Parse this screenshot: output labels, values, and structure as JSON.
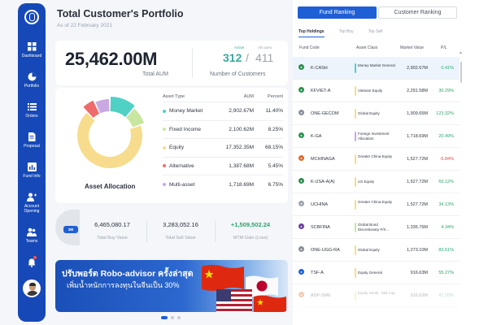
{
  "sidebar": {
    "items": [
      {
        "label": "Dashboard",
        "icon": "dashboard-icon"
      },
      {
        "label": "Portfolio",
        "icon": "pie-chart-icon"
      },
      {
        "label": "Orders",
        "icon": "list-icon"
      },
      {
        "label": "Proposal",
        "icon": "document-icon"
      },
      {
        "label": "Fund Info",
        "icon": "bar-chart-icon"
      },
      {
        "label": "Account Opening",
        "icon": "add-user-icon"
      },
      {
        "label": "Teams",
        "icon": "team-icon"
      }
    ]
  },
  "portfolio": {
    "title": "Total Customer's Portfolio",
    "date": "As of 22 February 2021",
    "aum_value": "25,462.00M",
    "aum_label": "Total AUM",
    "active_label": "Active",
    "allusers_label": "All users",
    "active_count": "312",
    "slash": "/",
    "all_count": "411",
    "customers_label": "Number of Customers"
  },
  "allocation": {
    "title": "Asset Allocation",
    "headers": {
      "type": "Asset Type",
      "aum": "AUM",
      "percent": "Percent"
    },
    "rows": [
      {
        "type": "Money Market",
        "aum": "2,902.67M",
        "percent": "11.40%",
        "color": "#4fd1c5"
      },
      {
        "type": "Fixed Income",
        "aum": "2,100.62M",
        "percent": "8.25%",
        "color": "#c8e6a0"
      },
      {
        "type": "Equity",
        "aum": "17,352.35M",
        "percent": "68.15%",
        "color": "#f6dc8c"
      },
      {
        "type": "Alternative",
        "aum": "1,387.68M",
        "percent": "5.45%",
        "color": "#ef6b6b"
      },
      {
        "type": "Multi-asset",
        "aum": "1,718.69M",
        "percent": "6.75%",
        "color": "#c9a8e3"
      }
    ]
  },
  "trading": {
    "period": "3M",
    "buy_value": "6,465,080.17",
    "buy_label": "Total Buy Value",
    "sell_value": "3,283,052.16",
    "sell_label": "Total Sell Value",
    "mtm_value": "+1,509,502.24",
    "mtm_label": "MTM Gain (Loss)"
  },
  "banner": {
    "line1": "ปรับพอร์ต Robo-advisor ครั้งล่าสุด",
    "line2": "เพิ่มน้ำหนักการลงทุนในจีนเป็น 30%"
  },
  "ranking": {
    "tab_fund": "Fund Ranking",
    "tab_customer": "Customer Ranking",
    "subtabs": [
      "Top Holdings",
      "Top Buy",
      "Top Sell"
    ],
    "headers": {
      "code": "Fund Code",
      "class": "Asset Class",
      "mv": "Market Value",
      "pl": "P/L"
    },
    "rows": [
      {
        "code": "K-CASH",
        "class": "Money Market General",
        "mv": "2,902.67M",
        "pl": "0.41%",
        "bar": "#4fd1c5",
        "icon": "#2f8f4e"
      },
      {
        "code": "KFVIET-A",
        "class": "Vietnam Equity",
        "mv": "2,291.58M",
        "pl": "30.29%",
        "bar": "#f6dc8c",
        "icon": "#2f8f4e"
      },
      {
        "code": "ONE-GECOM",
        "class": "Global Equity",
        "mv": "1,909.65M",
        "pl": "123.32%",
        "bar": "#f6dc8c",
        "icon": "#8a8f98"
      },
      {
        "code": "K-GA",
        "class": "Foreign Investment Allocation",
        "mv": "1,718.69M",
        "pl": "20.49%",
        "bar": "#c9a8e3",
        "icon": "#2f8f4e"
      },
      {
        "code": "MCHINAGA",
        "class": "Greater China Equity",
        "mv": "1,527.72M",
        "pl": "-5.84%",
        "bar": "#f6dc8c",
        "icon": "#e06a2c"
      },
      {
        "code": "K-USA-A(A)",
        "class": "US Equity",
        "mv": "1,527.72M",
        "pl": "69.12%",
        "bar": "#f6dc8c",
        "icon": "#2f8f4e"
      },
      {
        "code": "UCHINA",
        "class": "Greater China Equity",
        "mv": "1,527.72M",
        "pl": "34.13%",
        "bar": "#f6dc8c",
        "icon": "#9aa3ae"
      },
      {
        "code": "SCBFINA",
        "class": "Global Bond Discretionary F/X...",
        "mv": "1,336.76M",
        "pl": "4.34%",
        "bar": "#c8e6a0",
        "icon": "#6a3fa0"
      },
      {
        "code": "ONE-UGG-RA",
        "class": "Global Equity",
        "mv": "1,273.10M",
        "pl": "83.61%",
        "bar": "#f6dc8c",
        "icon": "#8a8f98"
      },
      {
        "code": "TSF-A",
        "class": "Equity General",
        "mv": "916.63M",
        "pl": "55.27%",
        "bar": "#f6dc8c",
        "icon": "#1f5fd6"
      },
      {
        "code": "ASP-SME",
        "class": "Equity Small - Mid Cap",
        "mv": "916.63M",
        "pl": "47.05%",
        "bar": "#f6dc8c",
        "icon": "#e06a2c"
      }
    ]
  }
}
